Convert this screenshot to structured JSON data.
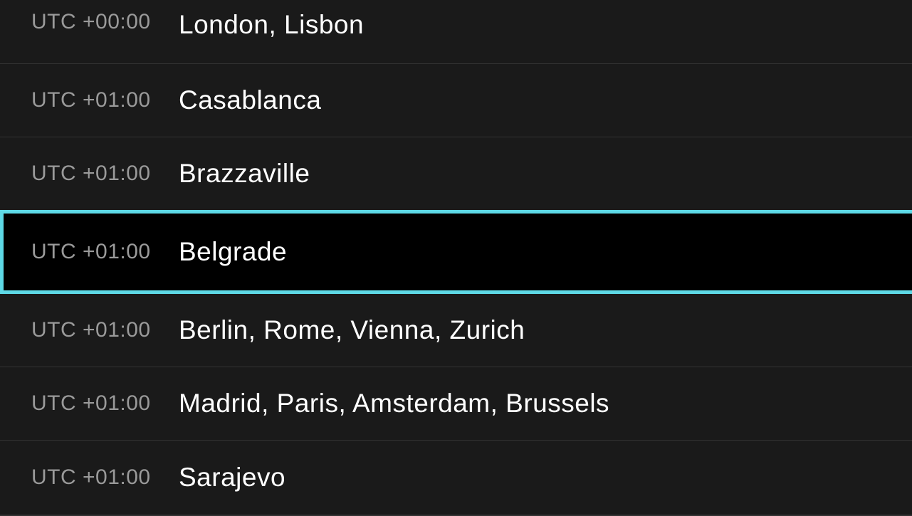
{
  "timezones": [
    {
      "offset": "UTC +00:00",
      "cities": "London, Lisbon",
      "selected": false
    },
    {
      "offset": "UTC +01:00",
      "cities": "Casablanca",
      "selected": false
    },
    {
      "offset": "UTC +01:00",
      "cities": "Brazzaville",
      "selected": false
    },
    {
      "offset": "UTC +01:00",
      "cities": "Belgrade",
      "selected": true
    },
    {
      "offset": "UTC +01:00",
      "cities": "Berlin, Rome, Vienna, Zurich",
      "selected": false
    },
    {
      "offset": "UTC +01:00",
      "cities": "Madrid, Paris, Amsterdam, Brussels",
      "selected": false
    },
    {
      "offset": "UTC +01:00",
      "cities": "Sarajevo",
      "selected": false
    }
  ]
}
